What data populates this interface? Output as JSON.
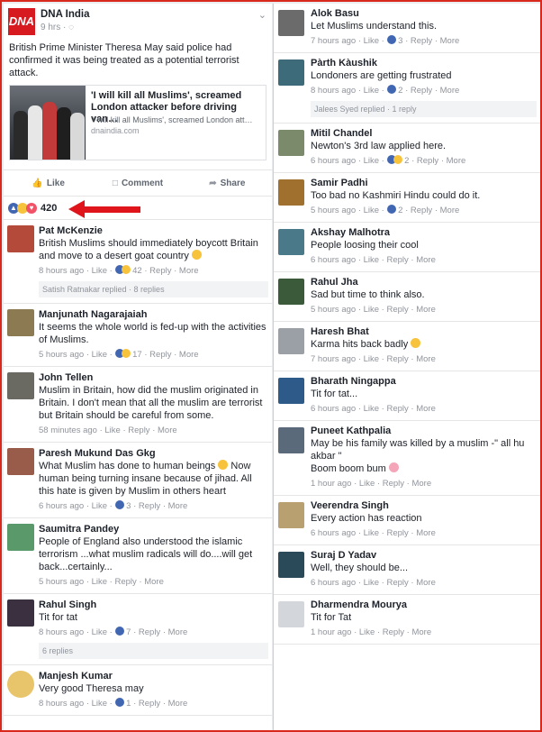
{
  "post": {
    "page_name": "DNA India",
    "logo_text": "DNA",
    "time": "9 hrs · ◌",
    "text": "British Prime Minister Theresa May said police had confirmed it was being treated as a potential terrorist attack.",
    "link": {
      "title": "'I will kill all Muslims', screamed London attacker before driving van…",
      "desc": "'I will kill all Muslims', screamed London att…",
      "domain": "dnaindia.com"
    },
    "actions": {
      "like": "Like",
      "comment": "Comment",
      "share": "Share"
    },
    "reaction_count": "420"
  },
  "left_comments": [
    {
      "name": "Pat McKenzie",
      "text": "British Muslims should immediately boycott Britain and move to a desert goat country",
      "meta": "8 hours ago · Like · ",
      "count": "42",
      "reply_box": "Satish Ratnakar replied · 8 replies"
    },
    {
      "name": "Manjunath Nagarajaiah",
      "text": "It seems the whole world is fed-up with the activities of Muslims.",
      "meta": "5 hours ago · Like · ",
      "count": "17"
    },
    {
      "name": "John Tellen",
      "text": "Muslim in Britain, how did the muslim originated in Britain. I don't mean that all the muslim are terrorist but Britain should be careful from some.",
      "meta": "58 minutes ago · Like · Reply · More"
    },
    {
      "name": "Paresh Mukund Das Gkg",
      "text": "What Muslim has done to human beings",
      "text2": "Now human being turning insane because of jihad. All this hate is given by Muslim in others heart",
      "meta": "6 hours ago · Like · ",
      "count": "3"
    },
    {
      "name": "Saumitra Pandey",
      "text": "People of England also understood the islamic terrorism ...what muslim radicals will do....will get back...certainly...",
      "meta": "5 hours ago · Like · Reply · More"
    },
    {
      "name": "Rahul Singh",
      "text": "Tit for tat",
      "meta": "8 hours ago · Like · ",
      "count": "7",
      "reply_box": "6 replies"
    },
    {
      "name": "Manjesh Kumar",
      "text": "Very good Theresa may",
      "meta": "8 hours ago · Like · ",
      "count": "1"
    }
  ],
  "right_comments": [
    {
      "name": "Alok Basu",
      "text": "Let Muslims understand this.",
      "meta": "7 hours ago · Like · ",
      "count": "3"
    },
    {
      "name": "Pàrth Kàushik",
      "text": "Londoners are getting frustrated",
      "meta": "8 hours ago · Like · ",
      "count": "2",
      "reply_box": "Jalees Syed replied · 1 reply"
    },
    {
      "name": "Mitil Chandel",
      "text": "Newton's 3rd law applied here.",
      "meta": "6 hours ago · Like · ",
      "count": "2"
    },
    {
      "name": "Samir Padhi",
      "text": "Too bad no Kashmiri Hindu could do it.",
      "meta": "5 hours ago · Like · ",
      "count": "2"
    },
    {
      "name": "Akshay Malhotra",
      "text": "People loosing their cool",
      "meta": "6 hours ago · Like · Reply · More"
    },
    {
      "name": "Rahul Jha",
      "text": "Sad but time to think also.",
      "meta": "5 hours ago · Like · Reply · More"
    },
    {
      "name": "Haresh Bhat",
      "text": "Karma hits back badly",
      "meta": "7 hours ago · Like · Reply · More"
    },
    {
      "name": "Bharath Ningappa",
      "text": "Tit for tat...",
      "meta": "6 hours ago · Like · Reply · More"
    },
    {
      "name": "Puneet Kathpalia",
      "text": "May be his family was killed by a muslim -\" all hu akbar \"",
      "text2": "Boom boom bum",
      "meta": "1 hour ago · Like · Reply · More"
    },
    {
      "name": "Veerendra Singh",
      "text": "Every action has reaction",
      "meta": "6 hours ago · Like · Reply · More"
    },
    {
      "name": "Suraj D Yadav",
      "text": "Well, they should be...",
      "meta": "6 hours ago · Like · Reply · More"
    },
    {
      "name": "Dharmendra Mourya",
      "text": "Tit for Tat",
      "meta": "1 hour ago · Like · Reply · More"
    }
  ],
  "tail": {
    "reply": "Reply",
    "more": "More"
  },
  "colors": {
    "frame": "#d9281c",
    "like_blue": "#4267b2",
    "haha_yellow": "#f7c33d",
    "love_red": "#f25268",
    "arrow": "#e0141b"
  }
}
